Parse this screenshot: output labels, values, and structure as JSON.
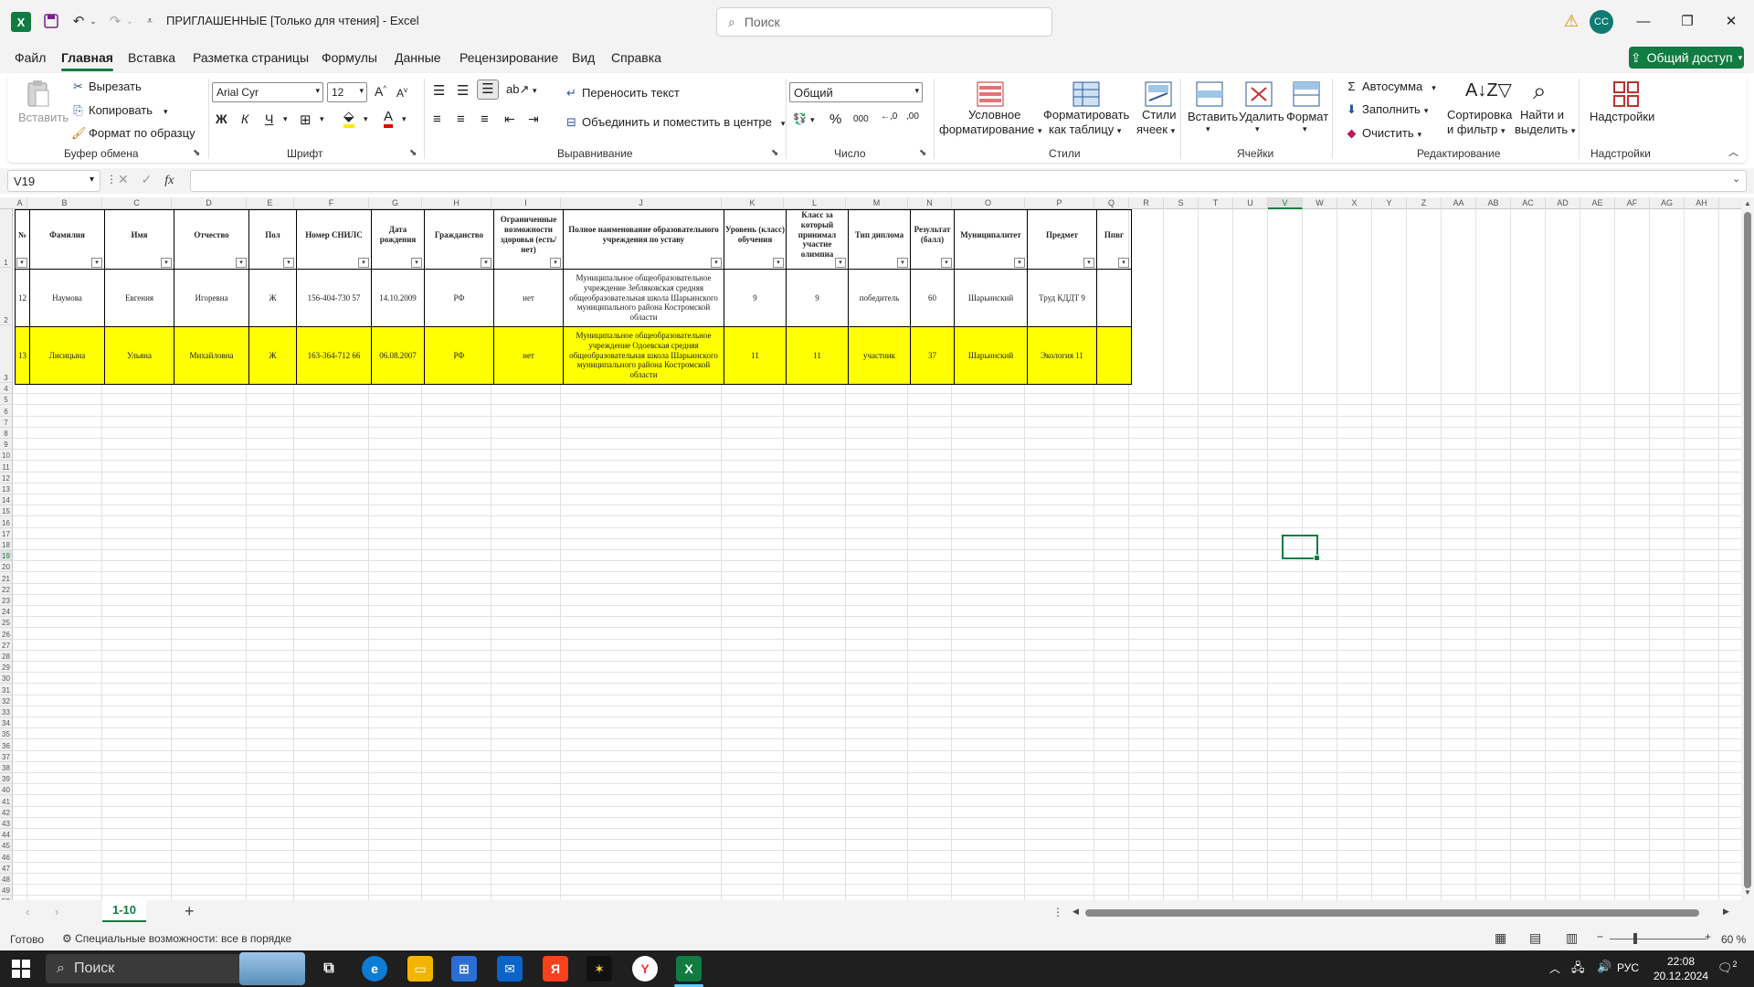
{
  "window": {
    "title": "ПРИГЛАШЕННЫЕ  [Только для чтения]  -  Excel",
    "search_placeholder": "Поиск",
    "user_initials": "CC",
    "minimize": "—",
    "restore": "❐",
    "close": "✕"
  },
  "menu": {
    "tabs": [
      "Файл",
      "Главная",
      "Вставка",
      "Разметка страницы",
      "Формулы",
      "Данные",
      "Рецензирование",
      "Вид",
      "Справка"
    ],
    "active_tab": "Главная",
    "share_label": "Общий доступ"
  },
  "ribbon": {
    "clipboard": {
      "paste": "Вставить",
      "cut": "Вырезать",
      "copy": "Копировать",
      "format_painter": "Формат по образцу",
      "group": "Буфер обмена"
    },
    "font": {
      "name": "Arial Cyr",
      "size": "12",
      "bold": "Ж",
      "italic": "К",
      "underline": "Ч",
      "group": "Шрифт"
    },
    "alignment": {
      "wrap_text": "Переносить текст",
      "merge_center": "Объединить и поместить в центре",
      "group": "Выравнивание"
    },
    "number": {
      "format": "Общий",
      "group": "Число"
    },
    "styles": {
      "conditional_1": "Условное",
      "conditional_2": "форматирование",
      "format_table_1": "Форматировать",
      "format_table_2": "как таблицу",
      "cell_styles_1": "Стили",
      "cell_styles_2": "ячеек",
      "group": "Стили"
    },
    "cells": {
      "insert": "Вставить",
      "delete": "Удалить",
      "format": "Формат",
      "group": "Ячейки"
    },
    "editing": {
      "autosum": "Автосумма",
      "fill": "Заполнить",
      "clear": "Очистить",
      "sort_1": "Сортировка",
      "sort_2": "и фильтр",
      "find_1": "Найти и",
      "find_2": "выделить",
      "group": "Редактирование"
    },
    "addins": {
      "label": "Надстройки",
      "group": "Надстройки"
    }
  },
  "formula_bar": {
    "name_box": "V19",
    "fx": "fx",
    "value": ""
  },
  "columns": [
    "A",
    "B",
    "C",
    "D",
    "E",
    "F",
    "G",
    "H",
    "I",
    "J",
    "K",
    "L",
    "M",
    "N",
    "O",
    "P",
    "Q",
    "R",
    "S",
    "T",
    "U",
    "V",
    "W",
    "X",
    "Y",
    "Z",
    "AA",
    "AB",
    "AC",
    "AD",
    "AE",
    "AF",
    "AG",
    "AH"
  ],
  "selected_column": "V",
  "selected_row": 19,
  "table": {
    "headers": [
      "№",
      "Фамилия",
      "Имя",
      "Отчество",
      "Пол",
      "Номер СНИЛС",
      "Дата рождения",
      "Гражданство",
      "Ограниченные возможности здоровья (есть/нет)",
      "Полное наименование образовательного учреждения по уставу",
      "Уровень (класс) обучения",
      "Класс за который принимал участие олимпиа",
      "Тип диплома",
      "Результат (балл)",
      "Муниципалитет",
      "Предмет",
      "Ппвг"
    ],
    "rows": [
      [
        "12",
        "Наумова",
        "Евгения",
        "Игоревна",
        "Ж",
        "156-404-730 57",
        "14.10.2009",
        "РФ",
        "нет",
        "Муниципальное общеобразовательное учреждение Зебляковская средняя общеобразовательная школа Шарьинского муниципального района Костромской области",
        "9",
        "9",
        "победитель",
        "60",
        "Шарьинский",
        "Труд КДДТ 9",
        ""
      ],
      [
        "13",
        "Лисицына",
        "Ульяна",
        "Михайловна",
        "Ж",
        "163-364-712 66",
        "06.08.2007",
        "РФ",
        "нет",
        "Муниципальное общеобразовательное учреждение Одоевская средняя общеобразовательная школа Шарьинского муниципального района Костромской области",
        "11",
        "11",
        "участник",
        "37",
        "Шарьинский",
        "Экология 11",
        ""
      ]
    ]
  },
  "sheet": {
    "active_tab": "1-10",
    "add": "+"
  },
  "status": {
    "ready": "Готово",
    "accessibility": "Специальные возможности: все в порядке",
    "zoom": "60 %"
  },
  "taskbar": {
    "search": "Поиск",
    "lang": "РУС",
    "time": "22:08",
    "date": "20.12.2024",
    "notifications": "2"
  },
  "colors": {
    "accent": "#107c41",
    "highlight_row": "#ffff00"
  }
}
